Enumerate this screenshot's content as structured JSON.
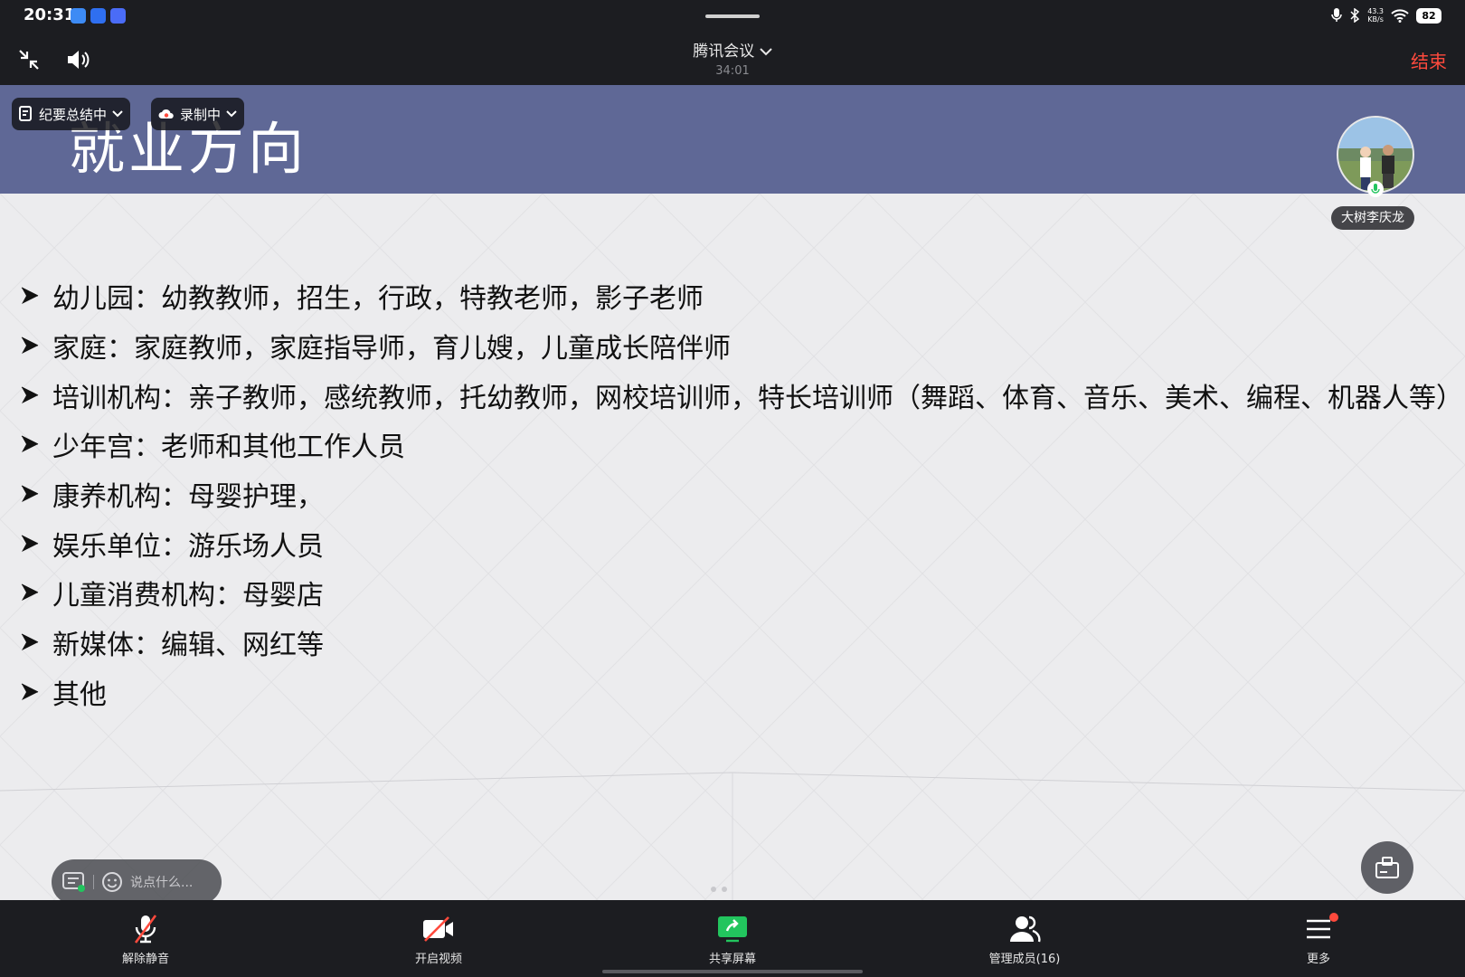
{
  "status_bar": {
    "time": "20:31",
    "net_speed_value": "43.3",
    "net_speed_unit": "KB/s",
    "battery": "82"
  },
  "meeting": {
    "app_title": "腾讯会议",
    "elapsed": "34:01",
    "end_label": "结束"
  },
  "chips": {
    "summary": "纪要总结中",
    "recording": "录制中"
  },
  "slide": {
    "title": "就业方向",
    "bullets": [
      "幼儿园：幼教教师，招生，行政，特教老师，影子老师",
      "家庭：家庭教师，家庭指导师，育儿嫂，儿童成长陪伴师",
      "培训机构：亲子教师，感统教师，托幼教师，网校培训师，特长培训师（舞蹈、体育、音乐、美术、编程、机器人等）",
      "少年宫：老师和其他工作人员",
      "康养机构：母婴护理，",
      "娱乐单位：游乐场人员",
      "儿童消费机构：母婴店",
      "新媒体：编辑、网红等",
      "其他"
    ]
  },
  "speaker": {
    "name": "大树李庆龙"
  },
  "comment": {
    "placeholder": "说点什么..."
  },
  "toolbar": {
    "unmute": "解除静音",
    "start_video": "开启视频",
    "share_screen": "共享屏幕",
    "manage_members": "管理成员(16)",
    "more": "更多"
  },
  "colors": {
    "slide_header": "#5f6896",
    "end_button": "#ff4a3d",
    "share_green": "#22c55e"
  }
}
